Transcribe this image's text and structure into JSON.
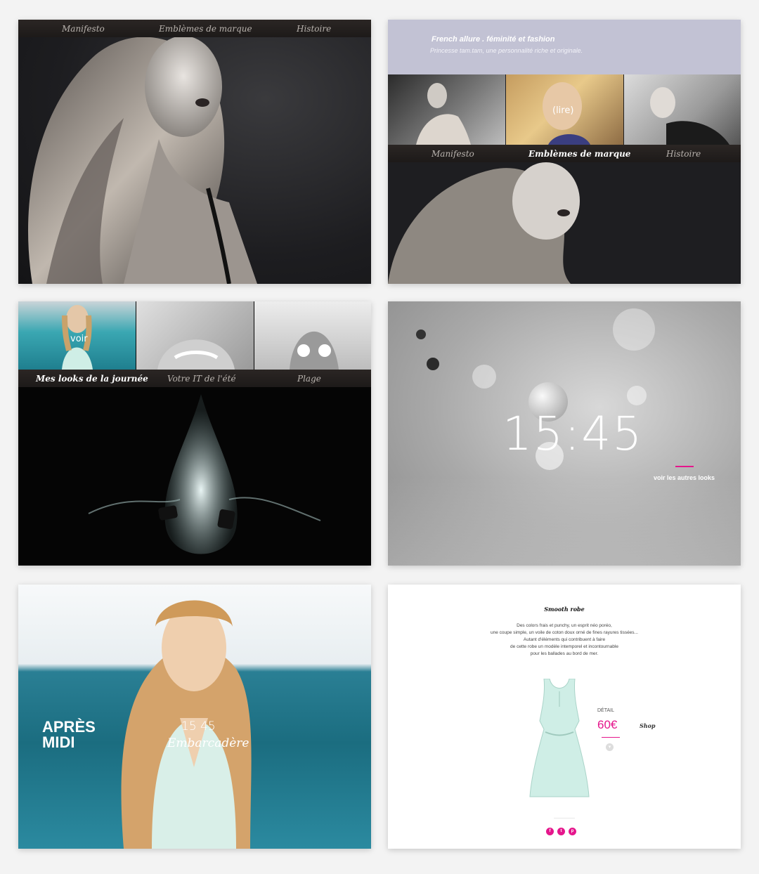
{
  "nav_main": [
    "Manifesto",
    "Emblèmes de marque",
    "Histoire"
  ],
  "p2": {
    "header_title": "French allure . féminité et fashion",
    "header_sub": "Princesse tam.tam, une personnalité riche et originale.",
    "lire_label": "(lire)"
  },
  "p3": {
    "nav": [
      "Mes looks de la journée",
      "Votre IT de l'été",
      "Plage"
    ],
    "voir_label": "voir"
  },
  "p4": {
    "time": "15:45",
    "link": "voir les autres looks"
  },
  "p5": {
    "title_line1": "APRÈS",
    "title_line2": "MIDI",
    "time": "15 45",
    "script_label": "Embarcadère"
  },
  "p6": {
    "product_title": "Smooth robe",
    "description": [
      "Des colors frais et punchy, un esprit néo poréo,",
      "une coupe simple, un voile de coton doux orné de fines rayures tissées...",
      "Autant d'éléments qui contribuent à faire",
      "de cette robe un modèle intemporel et incontournable",
      "pour les ballades au bord de mer."
    ],
    "detail_label": "DÉTAIL",
    "price": "60€",
    "shop_label": "Shop",
    "social": [
      "f",
      "t",
      "p"
    ]
  },
  "colors": {
    "accent_pink": "#e5168c",
    "lilac": "#c2c2d4",
    "nav_dark": "#231f1e"
  }
}
